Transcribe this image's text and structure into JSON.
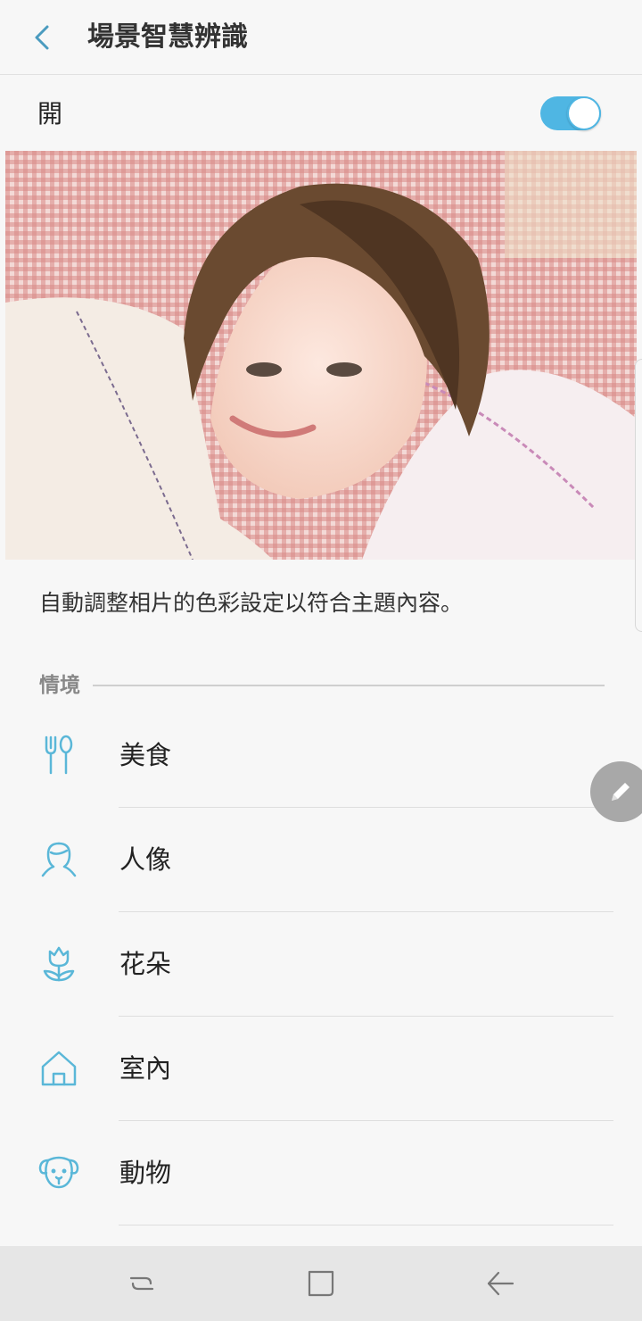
{
  "header": {
    "title": "場景智慧辨識",
    "back_icon": "chevron-left-icon"
  },
  "switch": {
    "label": "開",
    "on": true,
    "color": "#4fb6e3"
  },
  "description": "自動調整相片的色彩設定以符合主題內容。",
  "section": {
    "label": "情境"
  },
  "scenes": [
    {
      "label": "美食",
      "icon": "fork-knife-icon"
    },
    {
      "label": "人像",
      "icon": "portrait-icon"
    },
    {
      "label": "花朵",
      "icon": "flower-icon"
    },
    {
      "label": "室內",
      "icon": "house-icon"
    },
    {
      "label": "動物",
      "icon": "dog-icon"
    }
  ],
  "fab": {
    "icon": "pencil-icon"
  },
  "navbar": {
    "recent": "recent-apps-icon",
    "home": "home-icon",
    "back": "back-icon"
  },
  "colors": {
    "accent": "#4fb6e3",
    "icon": "#5ab7d8"
  }
}
